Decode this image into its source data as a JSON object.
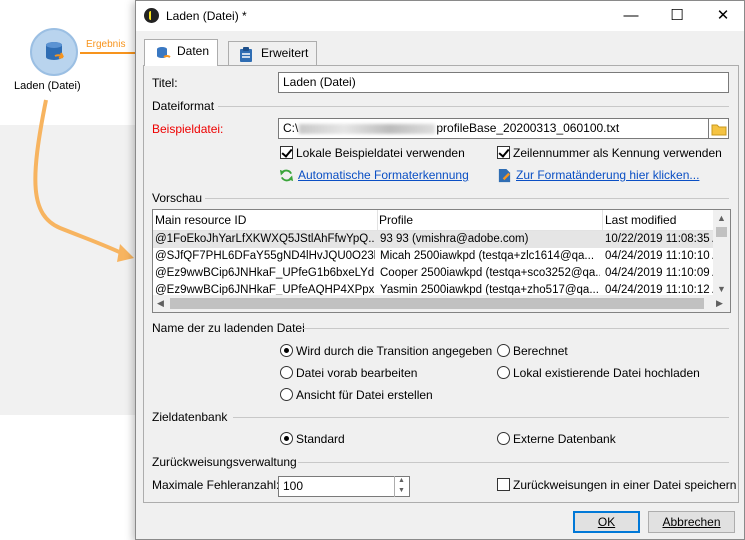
{
  "workflow": {
    "node_label": "Laden (Datei)",
    "transition_label": "Ergebnis"
  },
  "window": {
    "title": "Laden (Datei) *",
    "minimize": "—",
    "maximize": "☐",
    "close": "✕"
  },
  "tabs": [
    {
      "label": "Daten",
      "icon": "database-icon",
      "active": true
    },
    {
      "label": "Erweitert",
      "icon": "clipboard-icon",
      "active": false
    }
  ],
  "form": {
    "title_label": "Titel:",
    "title_value": "Laden (Datei)",
    "section_fileformat": "Dateiformat",
    "sample_file_label": "Beispieldatei:",
    "sample_file_value_prefix": "C:\\",
    "sample_file_value_suffix": "profileBase_20200313_060100.txt",
    "use_local_sample": "Lokale Beispieldatei verwenden",
    "use_line_number": "Zeilennummer als Kennung verwenden",
    "auto_format": "Automatische Formaterkennung",
    "change_format": "Zur Formatänderung hier klicken...",
    "section_preview": "Vorschau",
    "section_filename": "Name der zu ladenden Datei",
    "radio_transition": "Wird durch die Transition angegeben",
    "radio_calculated": "Berechnet",
    "radio_preprocess": "Datei vorab bearbeiten",
    "radio_upload_local": "Lokal existierende Datei hochladen",
    "radio_create_view": "Ansicht für Datei erstellen",
    "section_target_db": "Zieldatenbank",
    "radio_standard": "Standard",
    "radio_external": "Externe Datenbank",
    "section_reject": "Zurückweisungsverwaltung",
    "max_errors_label": "Maximale Fehleranzahl:",
    "max_errors_value": "100",
    "save_rejects": "Zurückweisungen in einer Datei speichern"
  },
  "preview": {
    "columns": [
      "Main resource ID",
      "Profile",
      "Last modified"
    ],
    "rows": [
      [
        "@1FoEkoJhYarLfXKWXQ5JStlAhFfwYpQ...",
        "93 93 (vmishra@adobe.com)",
        "10/22/2019 11:08:35 A"
      ],
      [
        "@SJfQF7PHL6DFaY55gND4lHvJQU0O23l_...",
        "Micah 2500iawkpd (testqa+zlc1614@qa...",
        "04/24/2019 11:10:10 A"
      ],
      [
        "@Ez9wwBCip6JNHkaF_UPfeG1b6bxeLYd...",
        "Cooper 2500iawkpd (testqa+sco3252@qa...",
        "04/24/2019 11:10:09 A"
      ],
      [
        "@Ez9wwBCip6JNHkaF_UPfeAQHP4XPpxB...",
        "Yasmin 2500iawkpd (testqa+zho517@qa...",
        "04/24/2019 11:10:12 A"
      ]
    ]
  },
  "buttons": {
    "ok": "OK",
    "cancel": "Abbrechen"
  },
  "colors": {
    "accent_orange": "#f7941d",
    "link_blue": "#0a4fc4",
    "required_red": "#e00000"
  }
}
